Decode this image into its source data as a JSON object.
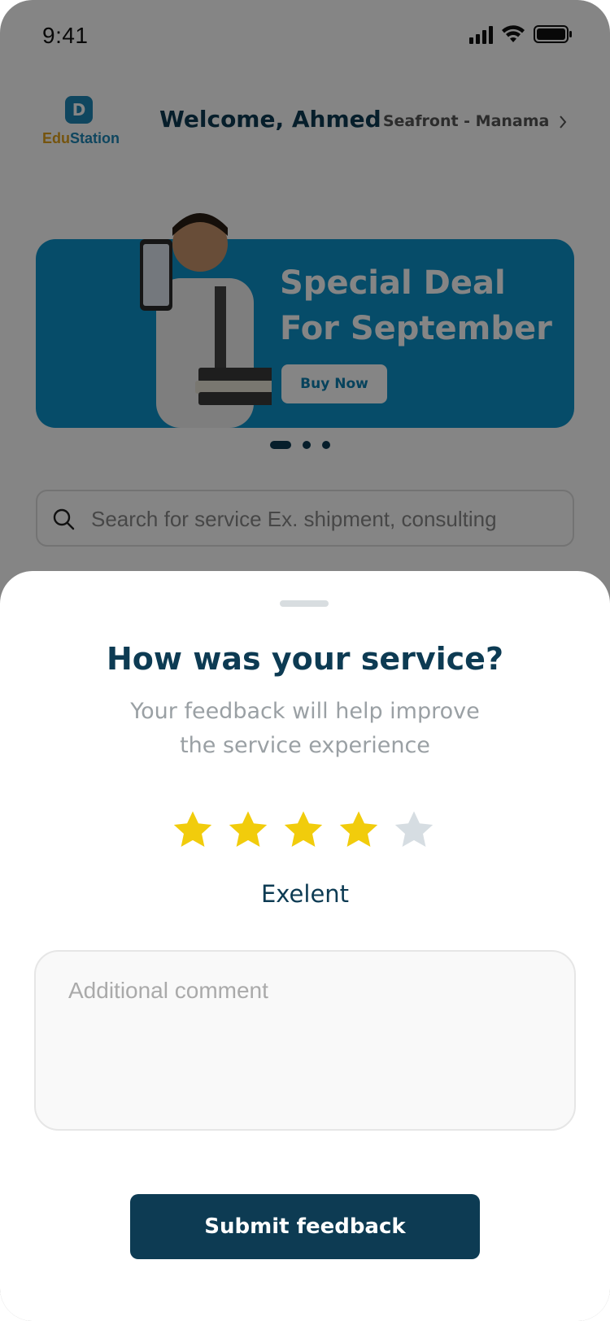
{
  "status_bar": {
    "time": "9:41"
  },
  "header": {
    "logo_prefix": "Edu",
    "logo_suffix": "Station",
    "welcome": "Welcome, Ahmed",
    "location": "Seafront - Manama"
  },
  "banner": {
    "title": "Special Deal For September",
    "button_label": "Buy Now",
    "page_count": 3,
    "active_page": 1
  },
  "search": {
    "placeholder": "Search for service Ex. shipment, consulting"
  },
  "feedback_sheet": {
    "title": "How was your service?",
    "subtitle": "Your feedback will help improve the service experience",
    "rating": 4,
    "max_rating": 5,
    "rating_label": "Exelent",
    "comment_placeholder": "Additional comment",
    "submit_label": "Submit feedback"
  },
  "colors": {
    "primary": "#0d3b53",
    "banner": "#0d92c9",
    "star_filled": "#f1cc0c",
    "star_empty": "#d6dde2",
    "overlay": "rgba(0,0,0,0.48)"
  },
  "icons": [
    "search-icon",
    "chevron-right-icon",
    "signal-icon",
    "wifi-icon",
    "battery-icon",
    "star-icon"
  ]
}
